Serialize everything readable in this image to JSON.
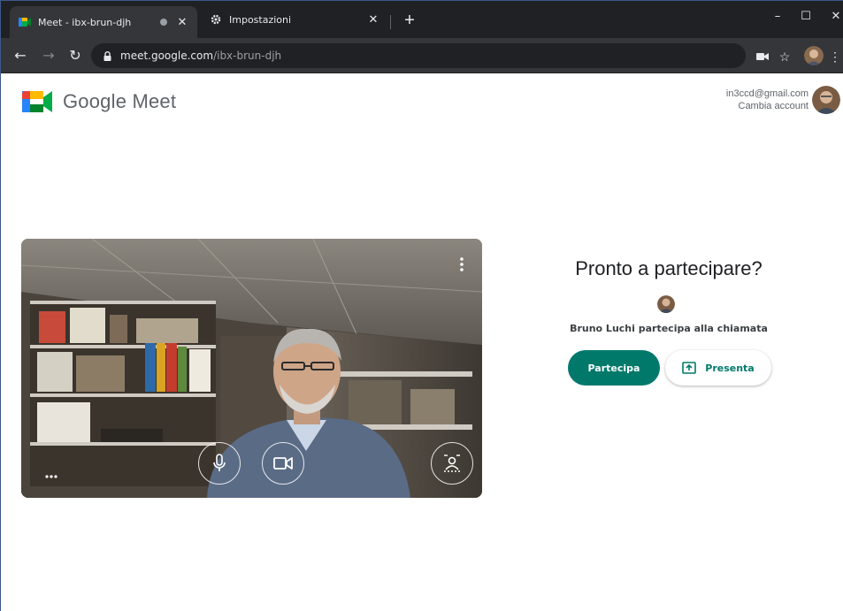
{
  "browser": {
    "tabs": [
      {
        "title": "Meet - ibx-brun-djh",
        "active": true,
        "icon": "meet-icon"
      },
      {
        "title": "Impostazioni",
        "active": false,
        "icon": "gear-icon"
      }
    ],
    "address": {
      "host": "meet.google.com",
      "path": "/ibx-brun-djh"
    }
  },
  "header": {
    "brand": "Google Meet",
    "account_email": "in3ccd@gmail.com",
    "switch_account": "Cambia account"
  },
  "join": {
    "title": "Pronto a partecipare?",
    "joining_text": "Bruno Luchi partecipa alla chiamata",
    "join_label": "Partecipa",
    "present_label": "Presenta"
  },
  "colors": {
    "accent": "#00796b",
    "tab_bar": "#202124",
    "toolbar": "#35363a"
  }
}
